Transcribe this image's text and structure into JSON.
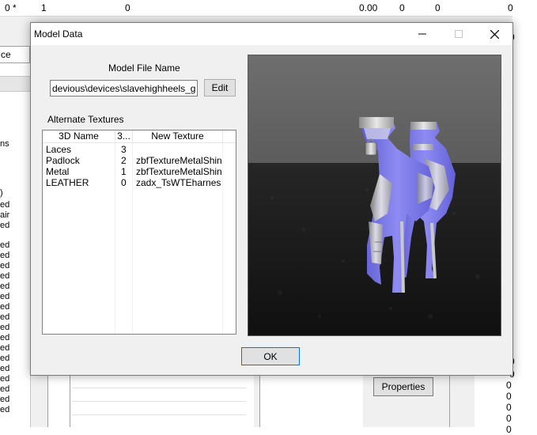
{
  "background": {
    "top_row": [
      "0 *",
      "1",
      "0",
      "0.00",
      "0",
      "0",
      "0"
    ],
    "left_field": "ce",
    "left_list": [
      "ns",
      ")",
      "ed",
      "air",
      "ed",
      "ed",
      "ed",
      "ed",
      "ed",
      "ed",
      "ed",
      "ed",
      "ed",
      "ed",
      "ed",
      "ed",
      "ed",
      "ed",
      "ed",
      "ed",
      "ed",
      "ed"
    ],
    "right_values": [
      "0",
      "0",
      "0",
      "0",
      "0"
    ],
    "right_strip_values": [
      "0",
      "0",
      "0"
    ],
    "properties_label": "Properties"
  },
  "dialog": {
    "title": "Model Data",
    "model_file_name_label": "Model File Name",
    "model_path": "devious\\devices\\slavehighheels_go.nif",
    "edit_label": "Edit",
    "alternate_textures_label": "Alternate Textures",
    "columns": [
      "3D Name",
      "3...",
      "New Texture"
    ],
    "rows": [
      {
        "name": "Laces",
        "index": "3",
        "texture": ""
      },
      {
        "name": "Padlock",
        "index": "2",
        "texture": "zbfTextureMetalShiny"
      },
      {
        "name": "Metal",
        "index": "1",
        "texture": "zbfTextureMetalShiny"
      },
      {
        "name": "LEATHER",
        "index": "0",
        "texture": "zadx_TsWTEharness"
      }
    ],
    "ok_label": "OK"
  },
  "colors": {
    "viewport_sky": "#6e6e6e",
    "viewport_ground": "#151515",
    "boot_purple": "#7b78e6",
    "boot_silver": "#c8c8c8"
  }
}
